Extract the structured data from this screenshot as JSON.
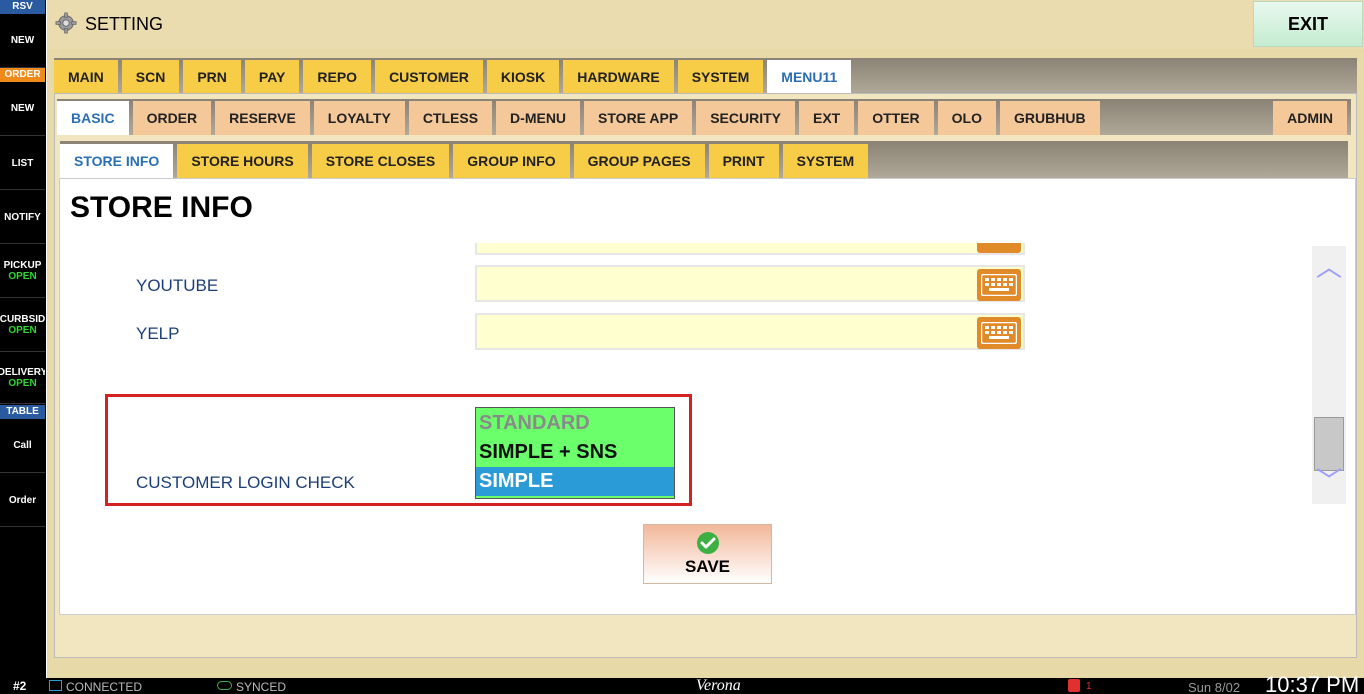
{
  "sidebar": {
    "rsv_label": "RSV",
    "rsv_new": "NEW",
    "order_label": "ORDER",
    "order_new": "NEW",
    "list": "LIST",
    "notify": "NOTIFY",
    "pickup": "PICKUP",
    "pickup_status": "OPEN",
    "curbside": "CURBSID",
    "curbside_status": "OPEN",
    "delivery": "DELIVERY",
    "delivery_status": "OPEN",
    "table_label": "TABLE",
    "call": "Call",
    "table_order": "Order"
  },
  "header": {
    "title": "SETTING",
    "exit_label": "EXIT"
  },
  "tabs_main": [
    "MAIN",
    "SCN",
    "PRN",
    "PAY",
    "REPO",
    "CUSTOMER",
    "KIOSK",
    "HARDWARE",
    "SYSTEM",
    "MENU11"
  ],
  "tabs_main_active": "MENU11",
  "tabs_sub": [
    "BASIC",
    "ORDER",
    "RESERVE",
    "LOYALTY",
    "CTLESS",
    "D-MENU",
    "STORE APP",
    "SECURITY",
    "EXT",
    "OTTER",
    "OLO",
    "GRUBHUB"
  ],
  "tabs_sub_active": "BASIC",
  "admin_label": "ADMIN",
  "tabs_third": [
    "STORE INFO",
    "STORE HOURS",
    "STORE CLOSES",
    "GROUP INFO",
    "GROUP PAGES",
    "PRINT",
    "SYSTEM"
  ],
  "tabs_third_active": "STORE INFO",
  "content": {
    "heading": "STORE INFO",
    "youtube_label": "YOUTUBE",
    "youtube_value": "",
    "yelp_label": "YELP",
    "yelp_value": "",
    "login_check_label": "CUSTOMER LOGIN CHECK",
    "login_options": [
      "STANDARD",
      "SIMPLE + SNS",
      "SIMPLE"
    ],
    "login_selected": "SIMPLE",
    "save_label": "SAVE"
  },
  "status": {
    "station": "#2",
    "connected": "CONNECTED",
    "synced": "SYNCED",
    "store_name": "Verona",
    "printer_count": "1",
    "date": "Sun 8/02",
    "time": "10:37 PM"
  },
  "colors": {
    "accent_blue": "#2a6fb5",
    "tab_yellow": "#f7cc47",
    "tab_peach": "#f5c89a",
    "select_green": "#6cff6c",
    "select_blue": "#2a9bd6",
    "highlight_red": "#d42222",
    "status_green": "#2fd62f"
  }
}
